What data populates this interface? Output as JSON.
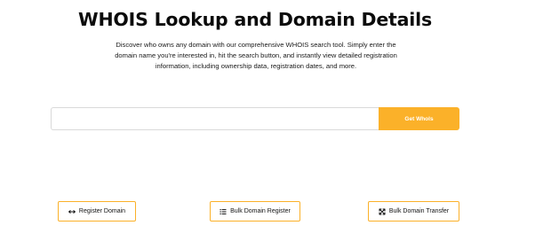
{
  "header": {
    "title": "WHOIS Lookup and Domain Details",
    "description": "Discover who owns any domain with our comprehensive WHOIS search tool. Simply enter the domain name you're interested in, hit the search button, and instantly view detailed registration information, including ownership data, registration dates, and more."
  },
  "search": {
    "value": "",
    "placeholder": "",
    "button_label": "Get WhoIs"
  },
  "actions": {
    "register_domain": {
      "label": "Register Domain",
      "icon": "arrows-horizontal-icon"
    },
    "bulk_domain_register": {
      "label": "Bulk Domain Register",
      "icon": "list-icon"
    },
    "bulk_domain_transfer": {
      "label": "Bulk Domain Transfer",
      "icon": "arrows-cross-icon"
    }
  },
  "colors": {
    "accent": "#fbb129",
    "text": "#111111",
    "input_border": "#d9d9d9"
  }
}
